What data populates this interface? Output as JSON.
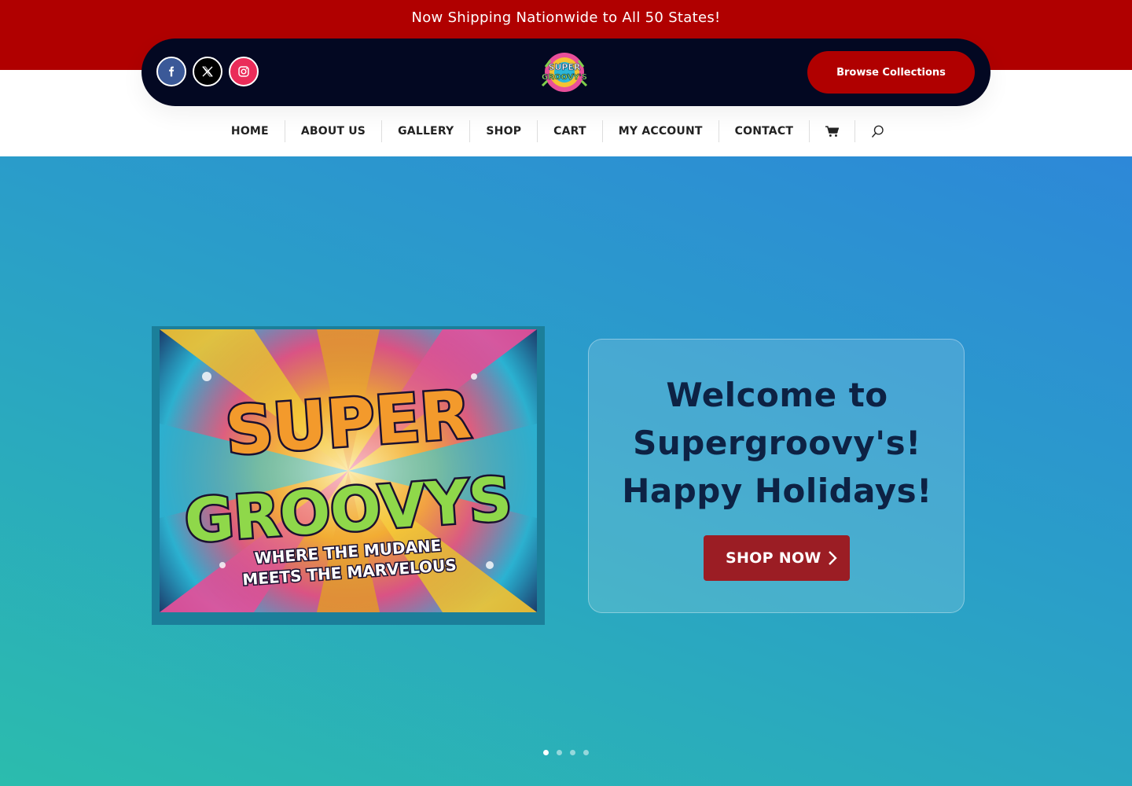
{
  "announcement": {
    "text": "Now Shipping Nationwide to All 50 States!"
  },
  "header": {
    "social": [
      {
        "name": "facebook-icon"
      },
      {
        "name": "x-twitter-icon"
      },
      {
        "name": "instagram-icon"
      }
    ],
    "logo": {
      "alt": "SUPER GROOVY'S"
    },
    "browse_label": "Browse Collections"
  },
  "nav": {
    "items": [
      {
        "label": "HOME"
      },
      {
        "label": "ABOUT US"
      },
      {
        "label": "GALLERY"
      },
      {
        "label": "SHOP"
      },
      {
        "label": "CART"
      },
      {
        "label": "MY ACCOUNT"
      },
      {
        "label": "CONTACT"
      }
    ]
  },
  "hero": {
    "image": {
      "line1": "SUPER",
      "line2": "GROOVYS",
      "tagline1": "WHERE THE MUDANE",
      "tagline2": "MEETS THE MARVELOUS"
    },
    "title_line1": "Welcome to",
    "title_line2": "Supergroovy's!",
    "title_line3": "Happy Holidays!",
    "cta_label": "SHOP NOW",
    "slider": {
      "total": 4,
      "active": 1
    }
  },
  "colors": {
    "brand_red": "#b00000",
    "header_dark": "#030822",
    "cta_red": "#9b1d24",
    "title_navy": "#0d2244"
  }
}
